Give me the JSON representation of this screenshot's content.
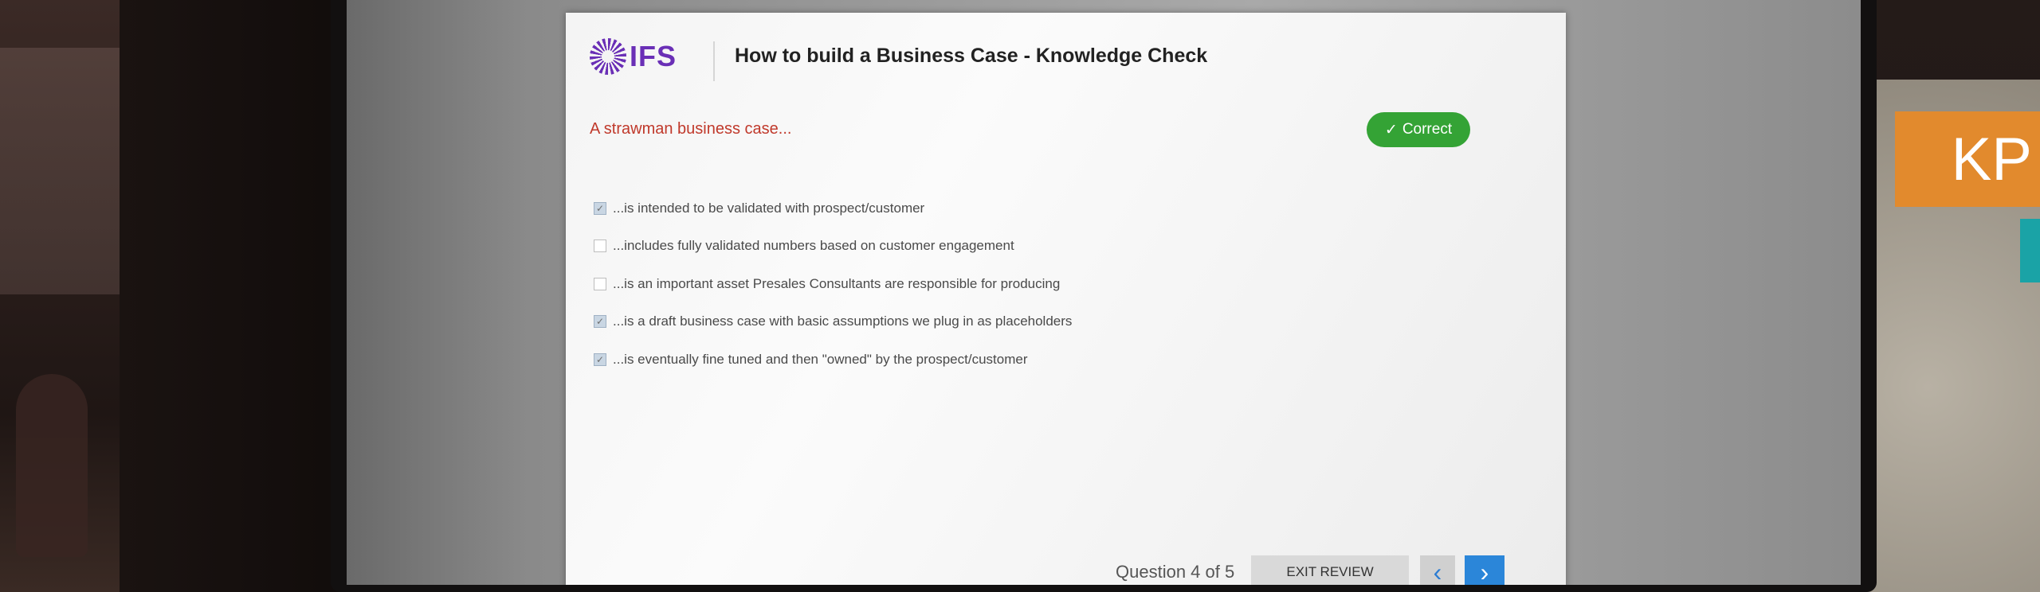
{
  "brand": {
    "logo_text": "IFS",
    "color": "#6a2fb6"
  },
  "header": {
    "title": "How to build a Business Case - Knowledge Check"
  },
  "question": {
    "text": "A strawman business case...",
    "result_badge": {
      "label": "Correct",
      "icon": "check-icon",
      "color": "#34a335"
    }
  },
  "options": [
    {
      "text": "...is intended to be validated with prospect/customer",
      "checked": true
    },
    {
      "text": "...includes fully validated numbers based on customer engagement",
      "checked": false
    },
    {
      "text": "...is an important asset Presales Consultants are responsible for producing",
      "checked": false
    },
    {
      "text": "...is a draft business case with basic assumptions we plug in as placeholders",
      "checked": true
    },
    {
      "text": "...is eventually fine tuned and then \"owned\" by the prospect/customer",
      "checked": true
    }
  ],
  "footer": {
    "progress": "Question 4 of 5",
    "exit_label": "EXIT REVIEW",
    "prev_icon": "chevron-left-icon",
    "next_icon": "chevron-right-icon"
  },
  "background": {
    "sign_text": "KP"
  }
}
